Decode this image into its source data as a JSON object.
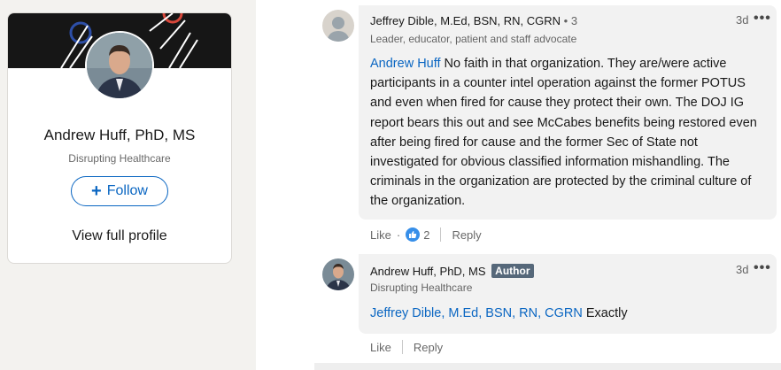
{
  "profile": {
    "name": "Andrew Huff, PhD, MS",
    "headline": "Disrupting Healthcare",
    "follow_label": "Follow",
    "view_profile_label": "View full profile",
    "accent_color": "#0a66c2"
  },
  "comments": [
    {
      "author": "Jeffrey Dible, M.Ed, BSN, RN, CGRN",
      "degree": "• 3",
      "headline": "Leader, educator, patient and staff advocate",
      "time": "3d",
      "more": "•••",
      "mention": "Andrew Huff",
      "text": " No faith in that organization. They are/were active participants in a counter intel operation against the former POTUS and even when fired for cause they protect their own. The DOJ IG report bears this out and see McCabes benefits being restored even after being fired for cause and the former Sec of State not investigated for obvious classified information mishandling. The criminals in the organization are protected by the criminal culture of the organization.",
      "like_label": "Like",
      "reaction_count": "2",
      "reply_label": "Reply",
      "avatar_icon": "default-person-icon"
    },
    {
      "author": "Andrew Huff, PhD, MS",
      "badge": "Author",
      "headline": "Disrupting Healthcare",
      "time": "3d",
      "more": "•••",
      "mention": "Jeffrey Dible, M.Ed, BSN, RN, CGRN",
      "text": " Exactly",
      "like_label": "Like",
      "reply_label": "Reply",
      "avatar_icon": "profile-photo"
    }
  ]
}
